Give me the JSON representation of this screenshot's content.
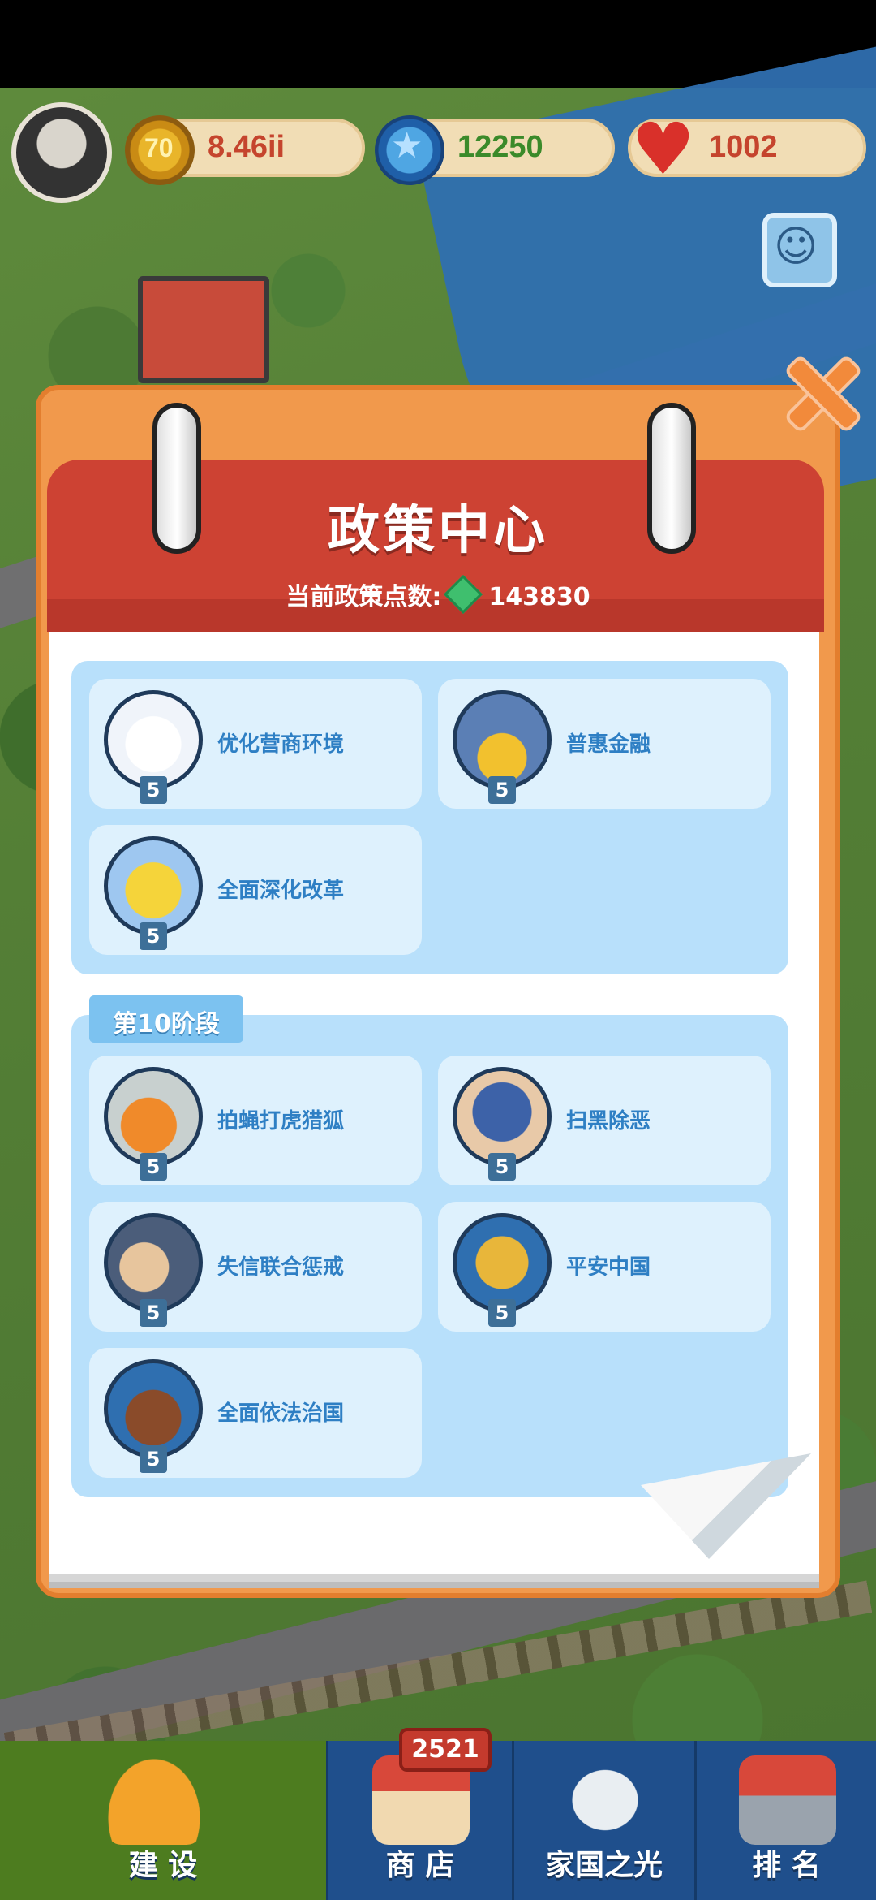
{
  "resources": {
    "coins": "8.46ii",
    "stars": "12250",
    "hearts": "1002"
  },
  "modal": {
    "title": "政策中心",
    "points_label": "当前政策点数:",
    "points_value": "143830"
  },
  "section1": {
    "cards": [
      {
        "label": "优化营商环境",
        "level": "5",
        "icon": "document-arrow-icon"
      },
      {
        "label": "普惠金融",
        "level": "5",
        "icon": "wallet-coins-icon"
      },
      {
        "label": "全面深化改革",
        "level": "5",
        "icon": "reform-sign-icon"
      }
    ]
  },
  "section2": {
    "stage": "第10阶段",
    "cards": [
      {
        "label": "拍蝇打虎猎狐",
        "level": "5",
        "icon": "tiger-fox-icon"
      },
      {
        "label": "扫黑除恶",
        "level": "5",
        "icon": "police-officer-icon"
      },
      {
        "label": "失信联合惩戒",
        "level": "5",
        "icon": "blacklist-board-icon"
      },
      {
        "label": "平安中国",
        "level": "5",
        "icon": "lock-shield-icon"
      },
      {
        "label": "全面依法治国",
        "level": "5",
        "icon": "gavel-book-icon"
      }
    ]
  },
  "nav": {
    "build": "建 设",
    "shop": "商 店",
    "shop_badge": "2521",
    "homeland": "家国之光",
    "rank": "排 名"
  },
  "colors": {
    "modal_orange": "#f1994c",
    "header_red": "#cd4233",
    "card_blue": "#def1fd",
    "label_blue": "#2e7fc4",
    "nav_blue": "#1f4f8c",
    "nav_active_green": "#4d7c1f"
  }
}
